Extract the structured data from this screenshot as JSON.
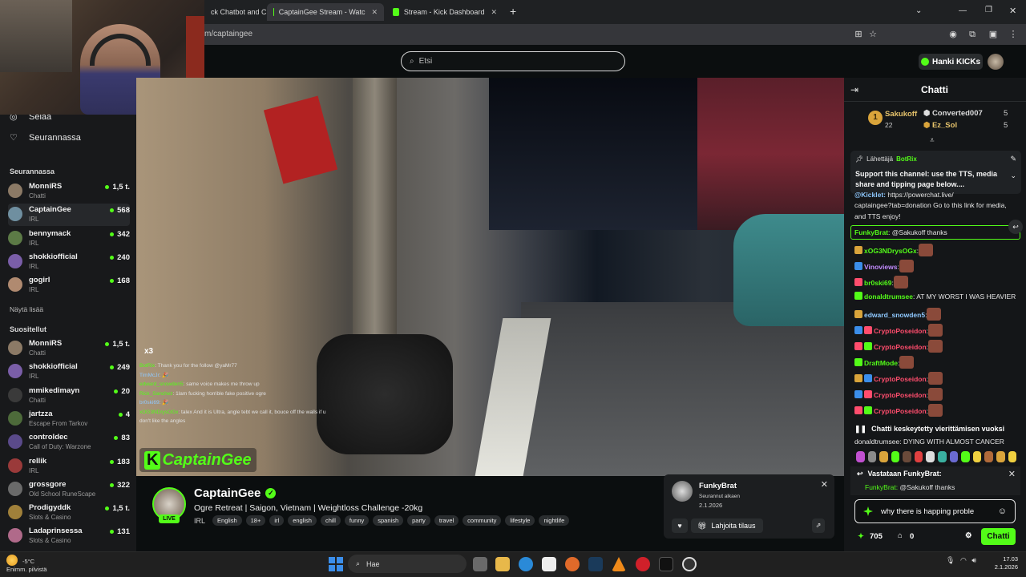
{
  "browser": {
    "tabs": [
      {
        "label": "ck Chatbot and C"
      },
      {
        "label": "CaptainGee Stream - Watc"
      },
      {
        "label": "Stream - Kick Dashboard"
      }
    ],
    "new_tab": "+",
    "url": "m/captaingee"
  },
  "topbar": {
    "search_placeholder": "Etsi",
    "get_kicks": "Hanki KICKs"
  },
  "sidebar": {
    "nav": [
      {
        "label": "Selaa"
      },
      {
        "label": "Seurannassa"
      }
    ],
    "following_header": "Seurannassa",
    "following": [
      {
        "name": "MonniRS",
        "category": "Chatti",
        "viewers": "1,5 t.",
        "avatar": "#8c7a66"
      },
      {
        "name": "CaptainGee",
        "category": "IRL",
        "viewers": "568",
        "avatar": "#6f8fa0"
      },
      {
        "name": "bennymack",
        "category": "IRL",
        "viewers": "342",
        "avatar": "#5c7a46"
      },
      {
        "name": "shokkiofficial",
        "category": "IRL",
        "viewers": "240",
        "avatar": "#7a5ea8"
      },
      {
        "name": "gogirl",
        "category": "IRL",
        "viewers": "168",
        "avatar": "#b08a70"
      }
    ],
    "show_more": "Näytä lisää",
    "recommended_header": "Suositellut",
    "recommended": [
      {
        "name": "MonniRS",
        "category": "Chatti",
        "viewers": "1,5 t.",
        "avatar": "#8c7a66"
      },
      {
        "name": "shokkiofficial",
        "category": "IRL",
        "viewers": "249",
        "avatar": "#7a5ea8"
      },
      {
        "name": "mmikedimayn",
        "category": "Chatti",
        "viewers": "20",
        "avatar": "#3a3a3a"
      },
      {
        "name": "jartzza",
        "category": "Escape From Tarkov",
        "viewers": "4",
        "avatar": "#4d6a3a"
      },
      {
        "name": "controldec",
        "category": "Call of Duty: Warzone",
        "viewers": "83",
        "avatar": "#5a4a8a"
      },
      {
        "name": "rellik",
        "category": "IRL",
        "viewers": "183",
        "avatar": "#9a3a3a"
      },
      {
        "name": "grossgore",
        "category": "Old School RuneScape",
        "viewers": "322",
        "avatar": "#6a6a6a"
      },
      {
        "name": "Prodigyddk",
        "category": "Slots & Casino",
        "viewers": "1,5 t.",
        "avatar": "#a0803a"
      },
      {
        "name": "Ladaprinsessa",
        "category": "Slots & Casino",
        "viewers": "131",
        "avatar": "#b06a8a"
      }
    ]
  },
  "video": {
    "overlay_counter": "x3",
    "watermark": "CaptainGee",
    "overlay_chat": [
      {
        "user": "BotRix",
        "text": ": Thank you for the follow @yaMr77"
      },
      {
        "user": "TimMcJr",
        "text": ": 🎉"
      },
      {
        "user": "edward_snowden5",
        "text": ": same voice makes me throw up"
      },
      {
        "user": "",
        "text": ""
      },
      {
        "user": "Rick_Sanchez",
        "text": ": 1lam fucking horrible fake positive ogre"
      },
      {
        "user": "br0ski69",
        "text": ": 🎉"
      },
      {
        "user": "xOG3NDrysOGx",
        "text": ": talex And it is Ultra, angle tebt we call it, bouce off the walls if u don't like the angles"
      }
    ]
  },
  "stream": {
    "channel": "CaptainGee",
    "live": "LIVE",
    "title": "Ogre Retreat | Saigon, Vietnam | Weightloss Challenge -20kg",
    "category": "IRL",
    "tags": [
      "English",
      "18+",
      "irl",
      "english",
      "chill",
      "funny",
      "spanish",
      "party",
      "travel",
      "community",
      "lifestyle",
      "nightlife"
    ]
  },
  "notification": {
    "name": "FunkyBrat",
    "status": "Seurannut alkaen",
    "date": "2.1.2026",
    "gift_label": "Lahjoita tilaus"
  },
  "chat": {
    "title": "Chatti",
    "top_gifters": [
      {
        "rank": "1",
        "name": "Sakukoff",
        "count": "22"
      },
      {
        "rank": "",
        "name": "Converted007",
        "count": "5"
      },
      {
        "rank": "",
        "name": "Ez_Sol",
        "count": "5"
      }
    ],
    "pinned": {
      "sender_label": "Lähettäjä",
      "sender": "BotRix",
      "text": "Support this channel: use the TTS, media share and tipping page below...."
    },
    "messages": [
      {
        "user": "@Kicklet:",
        "text": " https://powerchat.live/",
        "color": "#8fc9ff"
      },
      {
        "user": "",
        "text": "captaingee?tab=donation Go to this link for media,",
        "color": "#e6e6e6"
      },
      {
        "user": "",
        "text": "and TTS enjoy!",
        "color": "#e6e6e6"
      },
      {
        "user": "FunkyBrat",
        "text": ": @Sakukoff thanks",
        "color": "#53fc18"
      },
      {
        "user": "xOG3NDrysOGx",
        "text": ":",
        "color": "#53fc18"
      },
      {
        "user": "Vinoviews",
        "text": ":",
        "color": "#c38cff"
      },
      {
        "user": "br0ski69",
        "text": ":",
        "color": "#53fc18"
      },
      {
        "user": "donaldtrumsee",
        "text": ": AT MY WORST I WAS HEAVIER",
        "color": "#53fc18"
      },
      {
        "user": "edward_snowden5",
        "text": ":",
        "color": "#8fc9ff"
      },
      {
        "user": "CryptoPoseidon",
        "text": ":",
        "color": "#ff4d6d"
      },
      {
        "user": "CryptoPoseidon",
        "text": ":",
        "color": "#ff4d6d"
      },
      {
        "user": "DraftMode",
        "text": ":",
        "color": "#53fc18"
      },
      {
        "user": "CryptoPoseidon",
        "text": ":",
        "color": "#ff4d6d"
      },
      {
        "user": "CryptoPoseidon",
        "text": ":",
        "color": "#ff4d6d"
      },
      {
        "user": "CryptoPoseidon",
        "text": ":",
        "color": "#ff4d6d"
      }
    ],
    "paused": "Chatti keskeytetty vierittämisen vuoksi",
    "paused_msg": "donaldtrumsee: DYING WITH ALMOST CANCER",
    "reply_header": "Vastataan FunkyBrat:",
    "reply_user": "FunkyBrat:",
    "reply_text": " @Sakukoff thanks",
    "input_value": "why there is happing proble",
    "kicks_count": "705",
    "gift_count": "0",
    "send_label": "Chatti"
  },
  "taskbar": {
    "temperature": "-5°C",
    "weather": "Enimm. pilvistä",
    "search": "Hae",
    "time": "17.03",
    "date": "2.1.2026"
  }
}
